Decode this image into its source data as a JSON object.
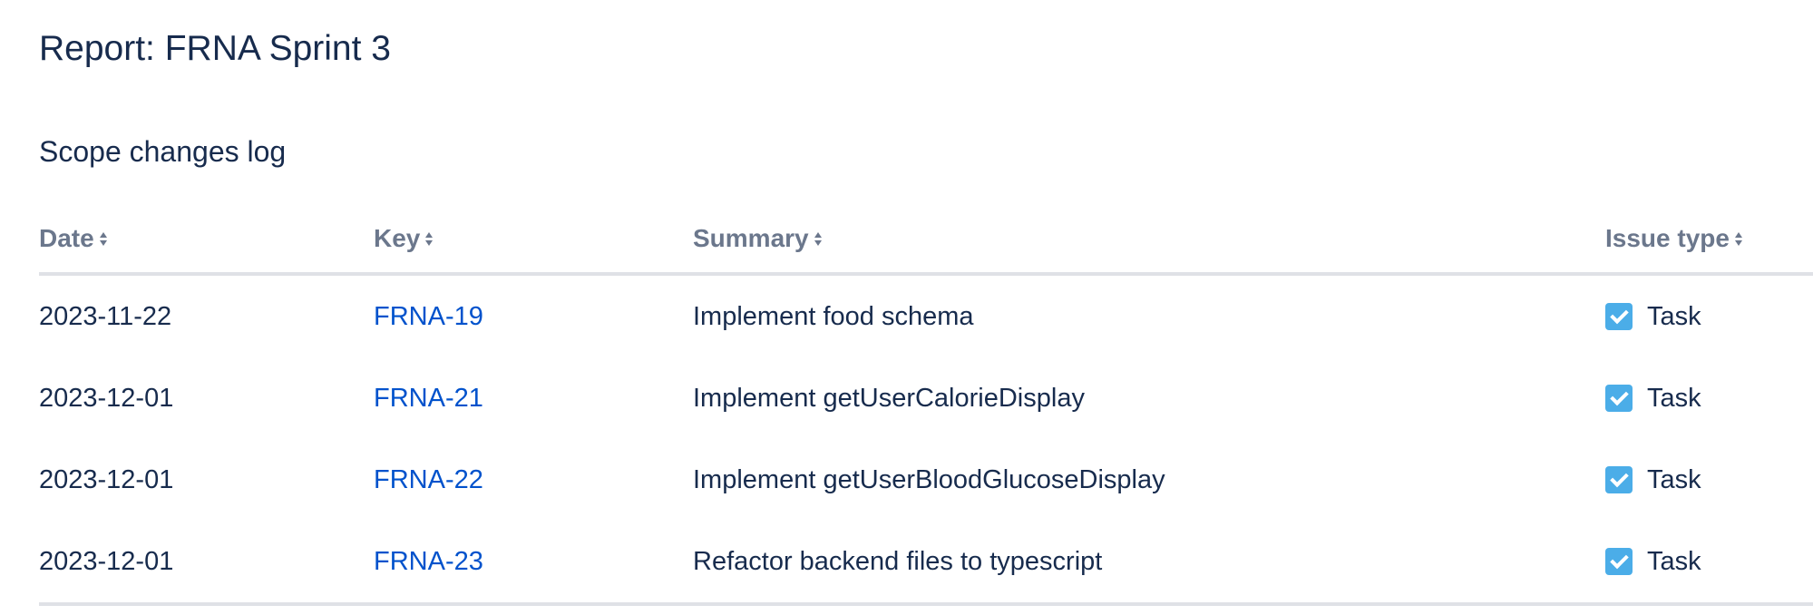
{
  "page": {
    "title": "Report: FRNA Sprint 3"
  },
  "section": {
    "title": "Scope changes log"
  },
  "table": {
    "columns": [
      {
        "label": "Date",
        "sortable": true
      },
      {
        "label": "Key",
        "sortable": true
      },
      {
        "label": "Summary",
        "sortable": true
      },
      {
        "label": "Issue type",
        "sortable": true
      }
    ],
    "rows": [
      {
        "date": "2023-11-22",
        "key": "FRNA-19",
        "summary": "Implement food schema",
        "issue_type": "Task",
        "issue_icon": "task-checkbox-icon"
      },
      {
        "date": "2023-12-01",
        "key": "FRNA-21",
        "summary": "Implement getUserCalorieDisplay",
        "issue_type": "Task",
        "issue_icon": "task-checkbox-icon"
      },
      {
        "date": "2023-12-01",
        "key": "FRNA-22",
        "summary": "Implement getUserBloodGlucoseDisplay",
        "issue_type": "Task",
        "issue_icon": "task-checkbox-icon"
      },
      {
        "date": "2023-12-01",
        "key": "FRNA-23",
        "summary": "Refactor backend files to typescript",
        "issue_type": "Task",
        "issue_icon": "task-checkbox-icon"
      }
    ]
  },
  "colors": {
    "heading": "#172b4d",
    "column_header": "#6b778c",
    "link": "#0052cc",
    "task_icon": "#4bade8",
    "divider": "#dfe1e6"
  }
}
